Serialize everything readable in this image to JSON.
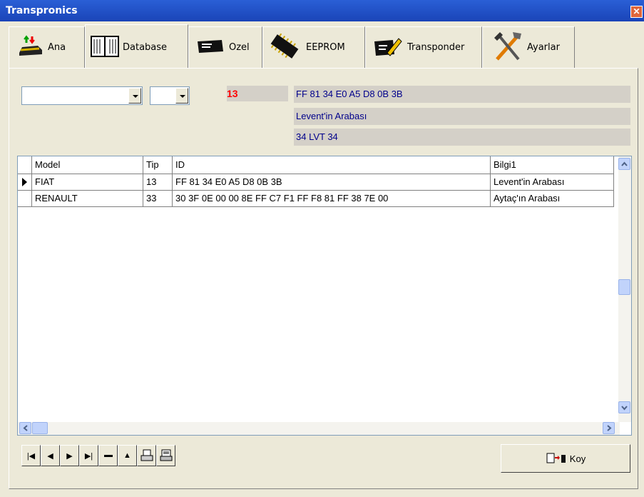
{
  "window": {
    "title": "Transpronics"
  },
  "tabs": [
    {
      "label": "Ana"
    },
    {
      "label": "Database"
    },
    {
      "label": "Ozel"
    },
    {
      "label": "EEPROM"
    },
    {
      "label": "Transponder"
    },
    {
      "label": "Ayarlar"
    }
  ],
  "filters": {
    "model_combo_value": "",
    "tip_combo_value": ""
  },
  "info": {
    "tip": "13",
    "id": "FF 81 34 E0 A5 D8 0B 3B",
    "bilgi1": "Levent'in Arabası",
    "bilgi2": "34 LVT 34"
  },
  "grid": {
    "columns": [
      "Model",
      "Tip",
      "ID",
      "Bilgi1"
    ],
    "rows": [
      {
        "model": "FIAT",
        "tip": "13",
        "id": "FF 81 34 E0 A5 D8 0B 3B",
        "bilgi1": "Levent'in Arabası"
      },
      {
        "model": "RENAULT",
        "tip": "33",
        "id": "30 3F 0E 00 00 8E FF C7  F1 FF F8 81 FF 38 7E 00",
        "bilgi1": "Aytaç'ın Arabası"
      }
    ]
  },
  "navigator": {
    "buttons": [
      "first",
      "prior",
      "next",
      "last",
      "delete",
      "edit",
      "print",
      "print-preview"
    ]
  },
  "koy_button": {
    "label": "Koy"
  }
}
